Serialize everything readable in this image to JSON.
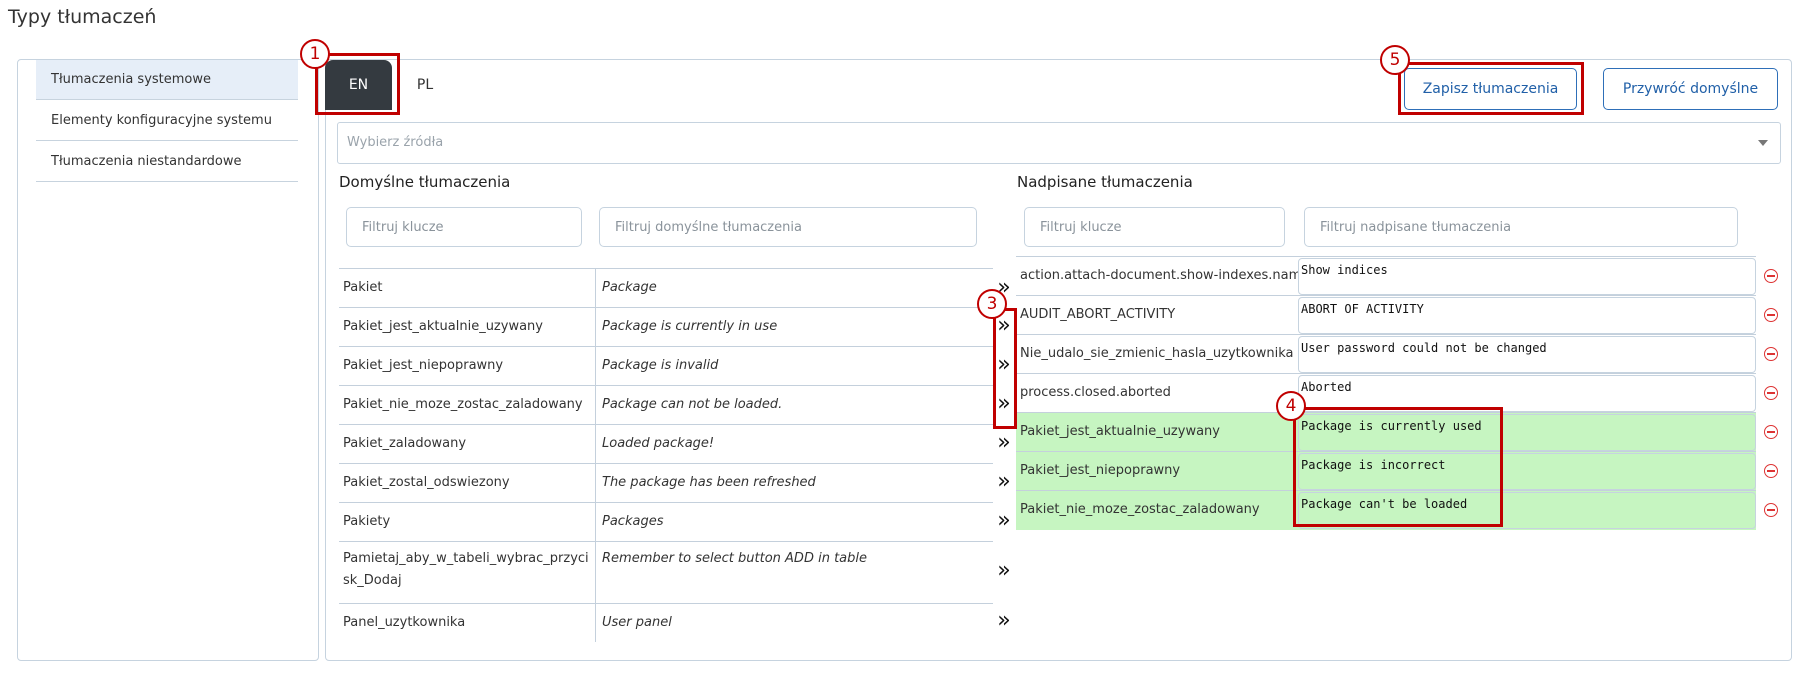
{
  "page": {
    "title": "Typy tłumaczeń"
  },
  "sidebar": {
    "items": [
      {
        "label": "Tłumaczenia systemowe",
        "active": true
      },
      {
        "label": "Elementy konfiguracyjne systemu"
      },
      {
        "label": "Tłumaczenia niestandardowe"
      }
    ]
  },
  "tabs": [
    {
      "label": "EN",
      "active": true
    },
    {
      "label": "PL"
    }
  ],
  "toolbar": {
    "save_label": "Zapisz tłumaczenia",
    "restore_label": "Przywróć domyślne"
  },
  "source_select": {
    "placeholder": "Wybierz źródła"
  },
  "default_section": {
    "title": "Domyślne tłumaczenia",
    "filter_keys_placeholder": "Filtruj klucze",
    "filter_values_placeholder": "Filtruj domyślne tłumaczenia",
    "rows": [
      {
        "key": "Pakiet",
        "value": "Package"
      },
      {
        "key": "Pakiet_jest_aktualnie_uzywany",
        "value": "Package is currently in use"
      },
      {
        "key": "Pakiet_jest_niepoprawny",
        "value": "Package is invalid"
      },
      {
        "key": "Pakiet_nie_moze_zostac_zaladowany",
        "value": "Package can not be loaded."
      },
      {
        "key": "Pakiet_zaladowany",
        "value": "Loaded package!"
      },
      {
        "key": "Pakiet_zostal_odswiezony",
        "value": "The package has been refreshed"
      },
      {
        "key": "Pakiety",
        "value": "Packages"
      },
      {
        "key": "Pamietaj_aby_w_tabeli_wybrac_przycisk_Dodaj",
        "value": "Remember to select button ADD in table"
      },
      {
        "key": "Panel_uzytkownika",
        "value": "User panel"
      }
    ],
    "move_icon": "»"
  },
  "override_section": {
    "title": "Nadpisane tłumaczenia",
    "filter_keys_placeholder": "Filtruj klucze",
    "filter_values_placeholder": "Filtruj nadpisane tłumaczenia",
    "rows": [
      {
        "key": "action.attach-document.show-indexes.name",
        "value": "Show indices",
        "new": false
      },
      {
        "key": "AUDIT_ABORT_ACTIVITY",
        "value": "ABORT OF ACTIVITY",
        "new": false
      },
      {
        "key": "Nie_udalo_sie_zmienic_hasla_uzytkownika",
        "value": "User password could not be changed",
        "new": false
      },
      {
        "key": "process.closed.aborted",
        "value": "Aborted",
        "new": false
      },
      {
        "key": "Pakiet_jest_aktualnie_uzywany",
        "value": "Package is currently used",
        "new": true
      },
      {
        "key": "Pakiet_jest_niepoprawny",
        "value": "Package is incorrect",
        "new": true
      },
      {
        "key": "Pakiet_nie_moze_zostac_zaladowany",
        "value": "Package can't be loaded",
        "new": true
      }
    ]
  },
  "annotations": {
    "callouts": [
      "1",
      "3",
      "4",
      "5"
    ]
  },
  "colors": {
    "accent": "#2160a8",
    "new_row": "#c6f5c1",
    "annotation": "#c00000",
    "active_tab": "#343a40",
    "remove_icon": "#dd3333"
  }
}
